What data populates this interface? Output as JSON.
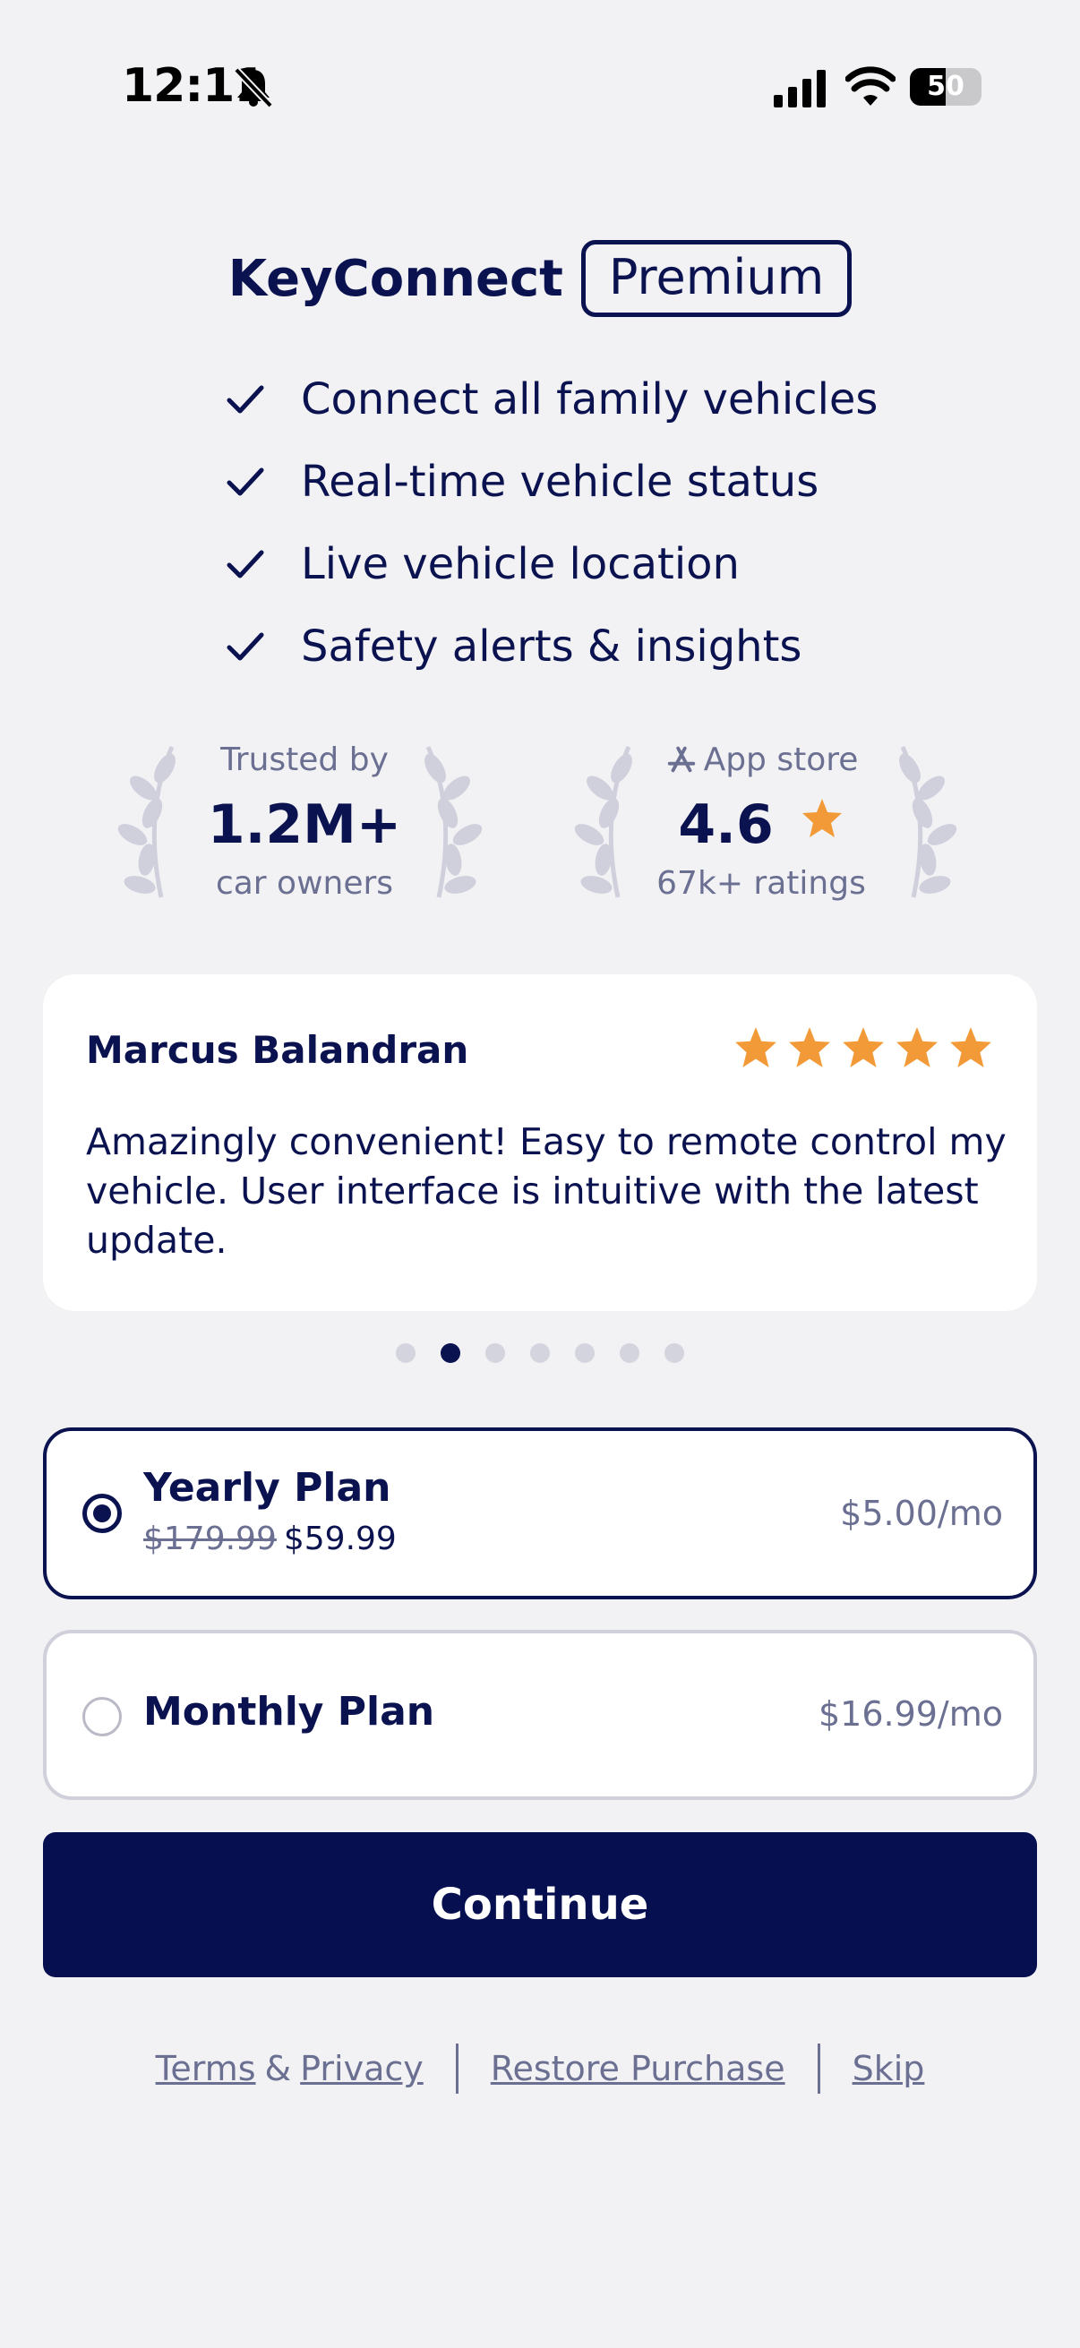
{
  "status_bar": {
    "time": "12:11",
    "battery": "50"
  },
  "header": {
    "brand": "KeyConnect",
    "badge": "Premium"
  },
  "features": [
    "Connect all family vehicles",
    "Real-time vehicle status",
    "Live vehicle location",
    "Safety alerts & insights"
  ],
  "stats": {
    "trusted": {
      "top": "Trusted by",
      "value": "1.2M+",
      "bottom": "car owners"
    },
    "appstore": {
      "top": "App store",
      "value": "4.6",
      "bottom": "67k+ ratings"
    }
  },
  "review": {
    "name": "Marcus Balandran",
    "rating": 5,
    "text": "Amazingly convenient! Easy to remote control my vehicle. User interface is intuitive with the latest update.",
    "page": 2,
    "pages": 7
  },
  "plans": {
    "yearly": {
      "name": "Yearly Plan",
      "old_price": "$179.99",
      "price": "$59.99",
      "per_month": "$5.00/mo",
      "selected": true
    },
    "monthly": {
      "name": "Monthly Plan",
      "per_month": "$16.99/mo",
      "selected": false
    }
  },
  "cta": {
    "label": "Continue"
  },
  "footer": {
    "terms": "Terms",
    "amp": "&",
    "privacy": "Privacy",
    "restore": "Restore Purchase",
    "skip": "Skip"
  },
  "colors": {
    "navy": "#0b1250",
    "button": "#061050",
    "star": "#f19a37",
    "muted": "#6b7092",
    "background": "#f2f2f4"
  }
}
